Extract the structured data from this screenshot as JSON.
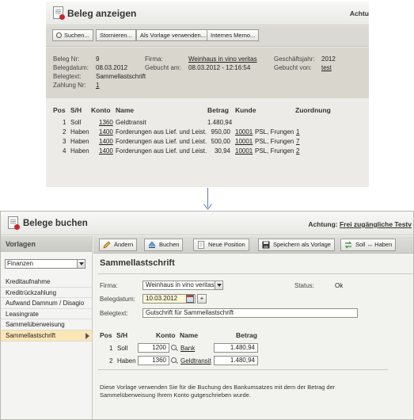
{
  "top": {
    "title": "Beleg anzeigen",
    "achtung": "Achtu",
    "toolbar": {
      "search": "Suchen...",
      "storno": "Stornieren...",
      "template": "Als Vorlage verwenden...",
      "memo": "Internes Memo..."
    },
    "info": {
      "belegnr_label": "Beleg Nr:",
      "belegnr": "9",
      "belegdatum_label": "Belegdatum:",
      "belegdatum": "08.03.2012",
      "belegtext_label": "Belegtext:",
      "belegtext": "Sammellastschrift",
      "zahlung_label": "Zahlung Nr:",
      "zahlung": "1",
      "firma_label": "Firma:",
      "firma": "Weinhaus in vino veritas",
      "gebucht_label": "Gebucht am:",
      "gebucht": "08.03.2012 - 12:16:54",
      "gj_label": "Geschäftsjahr:",
      "gj": "2012",
      "von_label": "Gebucht von:",
      "von": "test"
    },
    "table": {
      "headers": {
        "pos": "Pos",
        "sh": "S/H",
        "konto": "Konto",
        "name": "Name",
        "betrag": "Betrag",
        "kunde": "Kunde",
        "zuordnung": "Zuordnung"
      },
      "rows": [
        {
          "pos": "1",
          "sh": "Soll",
          "konto": "1360",
          "name": "Geldtransit",
          "betrag": "1.480,94",
          "kunde_nr": "",
          "kunde": "",
          "zuordnung": ""
        },
        {
          "pos": "2",
          "sh": "Haben",
          "konto": "1400",
          "name": "Forderungen aus Lief. und Leist.",
          "betrag": "950,00",
          "kunde_nr": "10001",
          "kunde": "PSL, Frungen",
          "zuordnung": "1"
        },
        {
          "pos": "3",
          "sh": "Haben",
          "konto": "1400",
          "name": "Forderungen aus Lief. und Leist.",
          "betrag": "500,00",
          "kunde_nr": "10001",
          "kunde": "PSL, Frungen",
          "zuordnung": "7"
        },
        {
          "pos": "4",
          "sh": "Haben",
          "konto": "1400",
          "name": "Forderungen aus Lief. und Leist.",
          "betrag": "30,94",
          "kunde_nr": "10001",
          "kunde": "PSL, Frungen",
          "zuordnung": "2"
        }
      ]
    }
  },
  "bottom": {
    "title": "Belege buchen",
    "achtung_label": "Achtung:",
    "achtung_link": "Frei zugängliche Testv",
    "sidebar": {
      "header": "Vorlagen",
      "select_value": "Finanzen",
      "items": [
        {
          "label": "Kreditaufnahme"
        },
        {
          "label": "Kreditrückzahlung"
        },
        {
          "label": "Aufwand Damnum / Disagio"
        },
        {
          "label": "Leasingrate"
        },
        {
          "label": "Sammelüberweisung"
        },
        {
          "label": "Sammellastschrift"
        }
      ]
    },
    "toolbar": {
      "aendern": "Ändern",
      "buchen": "Buchen",
      "neue_position": "Neue Position",
      "speichern": "Speichern als Vorlage",
      "soll_haben": "Soll ↔ Haben"
    },
    "form": {
      "heading": "Sammellastschrift",
      "firma_label": "Firma:",
      "firma_value": "Weinhaus in vino veritas",
      "status_label": "Status:",
      "status_value": "Ok",
      "belegdatum_label": "Belegdatum:",
      "belegdatum_value": "10.03.2012",
      "plus": "+",
      "belegtext_label": "Belegtext:",
      "belegtext_value": "Gutschrift für Sammellastschrift",
      "headers": {
        "pos": "Pos",
        "sh": "S/H",
        "konto": "Konto",
        "name": "Name",
        "betrag": "Betrag"
      },
      "rows": [
        {
          "pos": "1",
          "sh": "Soll",
          "konto": "1200",
          "name": "Bank",
          "betrag": "1.480,94"
        },
        {
          "pos": "2",
          "sh": "Haben",
          "konto": "1360",
          "name": "Geldtransit",
          "betrag": "1.480,94"
        }
      ],
      "note": "Diese Vorlage verwenden Sie für die Buchung des Bankumsatzes mit dem der Betrag der Sammelüberweisung Ihrem Konto gutgeschrieben wurde."
    }
  },
  "colors": {
    "connector": "#5a7fb8",
    "selected_item": "#fbe6b6",
    "date_field": "#fbf7d6"
  }
}
